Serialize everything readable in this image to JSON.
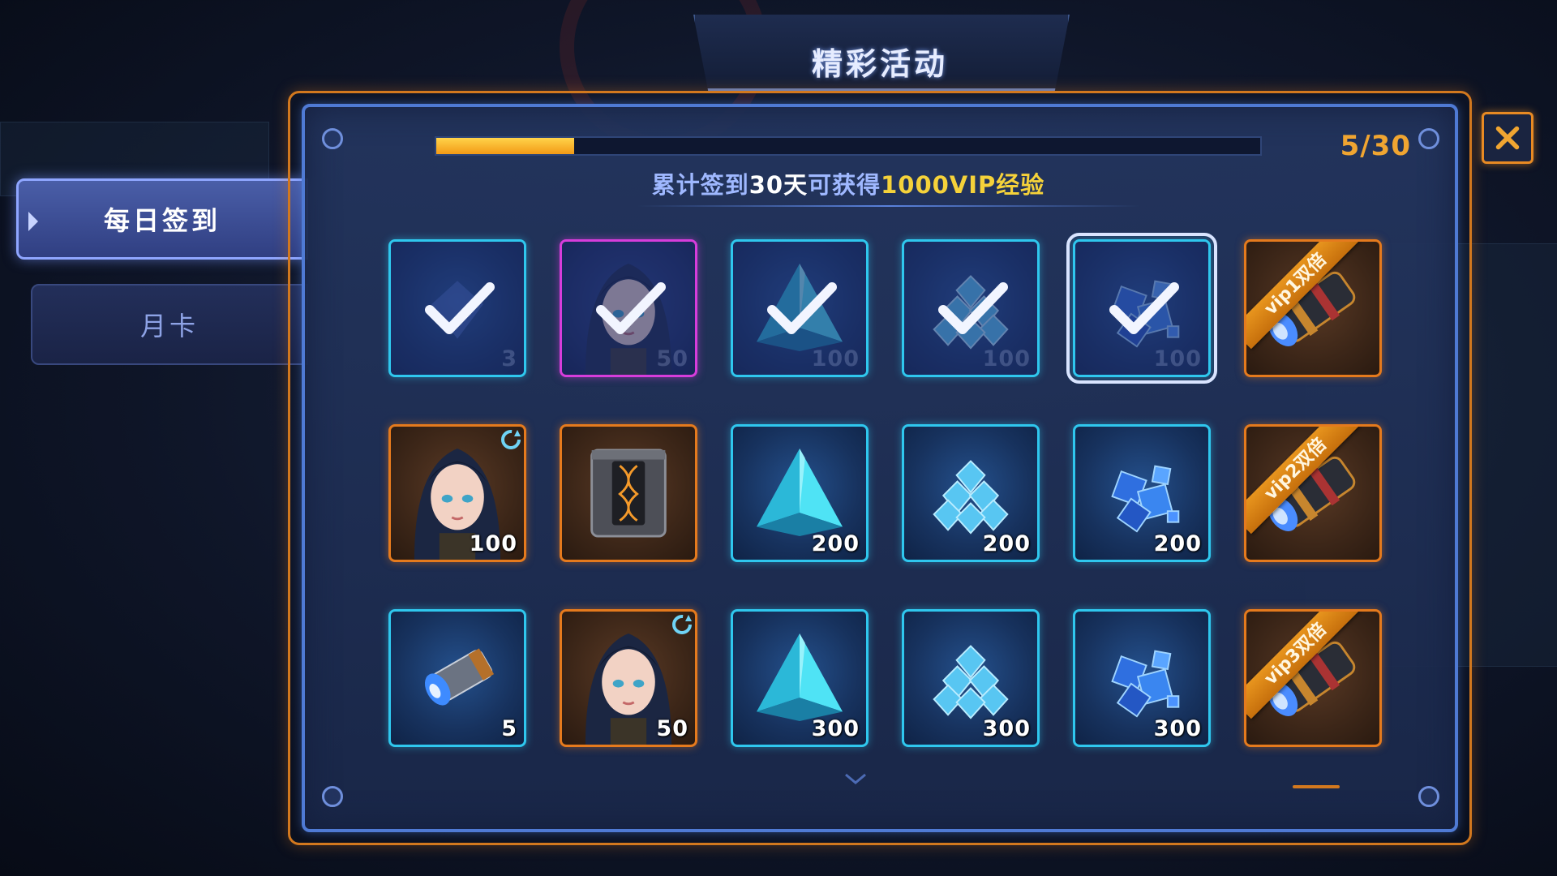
{
  "title": "精彩活动",
  "tabs": [
    {
      "label": "每日签到",
      "active": true
    },
    {
      "label": "月卡",
      "active": false
    }
  ],
  "close_icon": "close-icon",
  "progress": {
    "current": 5,
    "total": 30,
    "count_text": "5/30",
    "fraction": 0.167
  },
  "subtitle": {
    "part1": "累计签到",
    "days": "30天",
    "part2": "可获得",
    "reward": "1000VIP经验"
  },
  "rewards": [
    {
      "row": 0,
      "col": 0,
      "icon": "gem-icon",
      "qty": "3",
      "frame": "blue",
      "claimed": true
    },
    {
      "row": 0,
      "col": 1,
      "icon": "heroine-portrait",
      "qty": "50",
      "frame": "purple",
      "claimed": true
    },
    {
      "row": 0,
      "col": 2,
      "icon": "crystal-pyramid-icon",
      "qty": "100",
      "frame": "blue",
      "claimed": true
    },
    {
      "row": 0,
      "col": 3,
      "icon": "diamond-pile-icon",
      "qty": "100",
      "frame": "blue",
      "claimed": true
    },
    {
      "row": 0,
      "col": 4,
      "icon": "crystal-cubes-icon",
      "qty": "100",
      "frame": "blue",
      "claimed": true,
      "selected": true
    },
    {
      "row": 0,
      "col": 5,
      "icon": "engine-capsule-icon",
      "qty": "",
      "frame": "orange",
      "ribbon": "vip1双倍"
    },
    {
      "row": 1,
      "col": 0,
      "icon": "heroine-portrait",
      "qty": "100",
      "frame": "orange",
      "refresh": true
    },
    {
      "row": 1,
      "col": 1,
      "icon": "dna-crate-icon",
      "qty": "",
      "frame": "orange"
    },
    {
      "row": 1,
      "col": 2,
      "icon": "crystal-pyramid-icon",
      "qty": "200",
      "frame": "blue"
    },
    {
      "row": 1,
      "col": 3,
      "icon": "diamond-pile-icon",
      "qty": "200",
      "frame": "blue"
    },
    {
      "row": 1,
      "col": 4,
      "icon": "crystal-cubes-icon",
      "qty": "200",
      "frame": "blue"
    },
    {
      "row": 1,
      "col": 5,
      "icon": "engine-capsule-icon",
      "qty": "",
      "frame": "orange",
      "ribbon": "vip2双倍"
    },
    {
      "row": 2,
      "col": 0,
      "icon": "flashlight-capsule-icon",
      "qty": "5",
      "frame": "blue"
    },
    {
      "row": 2,
      "col": 1,
      "icon": "heroine-portrait",
      "qty": "50",
      "frame": "orange",
      "refresh": true
    },
    {
      "row": 2,
      "col": 2,
      "icon": "crystal-pyramid-icon",
      "qty": "300",
      "frame": "blue"
    },
    {
      "row": 2,
      "col": 3,
      "icon": "diamond-pile-icon",
      "qty": "300",
      "frame": "blue"
    },
    {
      "row": 2,
      "col": 4,
      "icon": "crystal-cubes-icon",
      "qty": "300",
      "frame": "blue"
    },
    {
      "row": 2,
      "col": 5,
      "icon": "engine-capsule-icon",
      "qty": "",
      "frame": "orange",
      "ribbon": "vip3双倍"
    }
  ],
  "colors": {
    "accent_orange": "#e57a1d",
    "cell_cyan": "#2fc7ee",
    "cell_purple": "#d63ddb",
    "progress_gold": "#f39a16",
    "reward_yellow": "#f5d23a"
  }
}
